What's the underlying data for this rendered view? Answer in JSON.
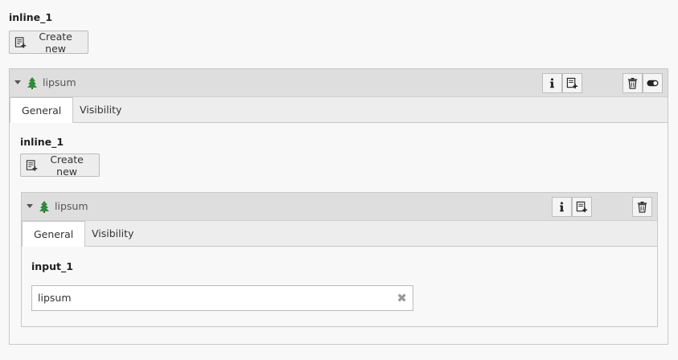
{
  "outer": {
    "field_label": "inline_1",
    "create_new_label": "Create new",
    "record": {
      "title": "lipsum",
      "tabs": [
        "General",
        "Visibility"
      ]
    }
  },
  "inner": {
    "field_label": "inline_1",
    "create_new_label": "Create new",
    "record": {
      "title": "lipsum",
      "tabs": [
        "General",
        "Visibility"
      ],
      "input_label": "input_1",
      "input_value": "lipsum"
    }
  },
  "icons": {
    "collapse": "caret-down-icon",
    "record": "tree-icon",
    "info": "info-icon",
    "new_after": "new-record-after-icon",
    "delete": "trash-icon",
    "hide": "toggle-icon",
    "clear": "close-icon"
  },
  "colors": {
    "tree_green": "#2e8b3a",
    "header_bg": "#dedede",
    "tab_bar_bg": "#ededed"
  }
}
